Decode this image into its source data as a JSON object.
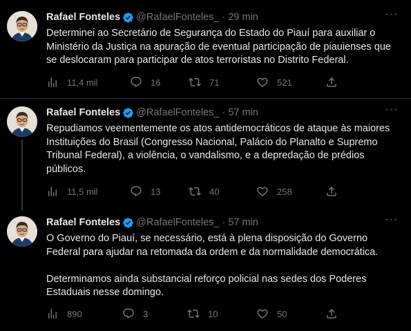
{
  "tweets": [
    {
      "name": "Rafael Fonteles",
      "handle": "@RafaelFonteles_",
      "separator": "·",
      "time": "29 min",
      "paragraphs": [
        "Determinei ao Secretário de Segurança do Estado do Piauí para auxiliar o Ministério da Justiça na apuração de eventual participação de piauienses que se deslocaram para participar de atos terroristas no Distrito Federal."
      ],
      "views": "11,4 mil",
      "replies": "16",
      "retweets": "71",
      "likes": "521"
    },
    {
      "name": "Rafael Fonteles",
      "handle": "@RafaelFonteles_",
      "separator": "·",
      "time": "57 min",
      "paragraphs": [
        "Repudiamos veementemente os atos antidemocráticos de ataque às maiores Instituições do Brasil (Congresso Nacional, Palácio do Planalto e Supremo Tribunal Federal), a violência, o vandalismo, e a depredação de prédios públicos."
      ],
      "views": "11,5 mil",
      "replies": "13",
      "retweets": "40",
      "likes": "258"
    },
    {
      "name": "Rafael Fonteles",
      "handle": "@RafaelFonteles_",
      "separator": "·",
      "time": "57 min",
      "paragraphs": [
        "O Governo do Piauí, se necessário, está à plena disposição do Governo Federal para ajudar na retomada da ordem e da normalidade democrática.",
        "Determinamos ainda substancial reforço policial nas sedes dos Poderes Estaduais nesse domingo."
      ],
      "views": "890",
      "replies": "3",
      "retweets": "10",
      "likes": "50"
    }
  ],
  "more_glyph": "···",
  "colors": {
    "background": "#000000",
    "text": "#e7e9ea",
    "muted": "#71767b",
    "verified": "#1d9bf0",
    "divider": "#2f3336"
  },
  "icons": [
    "verified-badge-icon",
    "more-icon",
    "views-icon",
    "reply-icon",
    "retweet-icon",
    "like-icon",
    "share-icon"
  ]
}
